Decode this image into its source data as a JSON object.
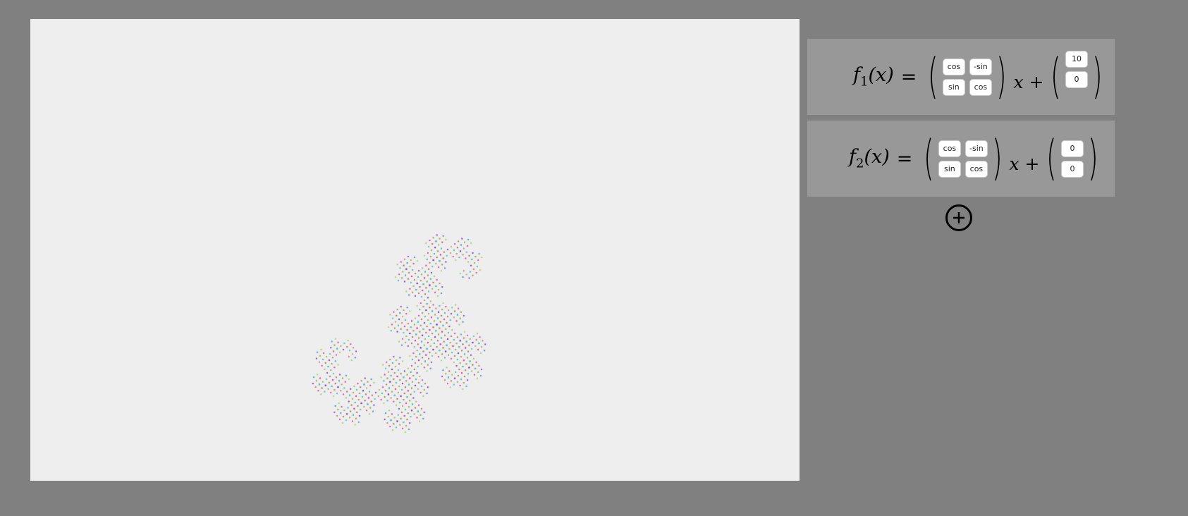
{
  "transforms": [
    {
      "name": "f",
      "index": "1",
      "arg": "(x)",
      "equals": "=",
      "x_term": "x",
      "plus": "+",
      "matrix": [
        [
          "cos",
          "-sin"
        ],
        [
          "sin",
          "cos"
        ]
      ],
      "vector": [
        "10",
        "0"
      ]
    },
    {
      "name": "f",
      "index": "2",
      "arg": "(x)",
      "equals": "=",
      "x_term": "x",
      "plus": "+",
      "matrix": [
        [
          "cos",
          "-sin"
        ],
        [
          "sin",
          "cos"
        ]
      ],
      "vector": [
        "0",
        "0"
      ]
    }
  ],
  "add_button": {
    "icon": "plus-circle-icon"
  },
  "colors": {
    "background": "#808080",
    "canvas": "#eeeeee",
    "panel": "#989898"
  },
  "fractal": {
    "type": "dragon-curve IFS point cloud",
    "coloring": "hue gradient (red, orange, yellow, green, cyan, blue, magenta)"
  }
}
